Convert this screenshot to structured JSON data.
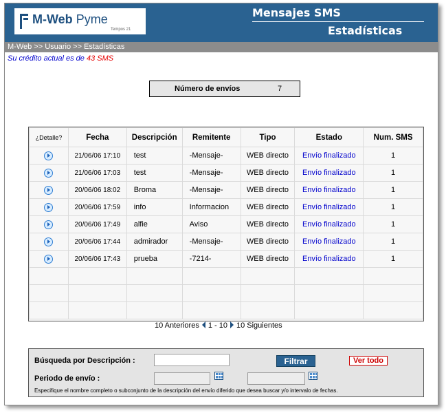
{
  "header": {
    "logo_text_prefix": "M-Web",
    "logo_text_suffix": "Pyme",
    "logo_tagline": "Tempos 21",
    "title": "Mensajes SMS",
    "subtitle": "Estadísticas"
  },
  "breadcrumb": "M-Web >> Usuario >> Estadísticas",
  "credit": {
    "text": "Su crédito actual es de ",
    "amount": "43 SMS"
  },
  "summary": {
    "label": "Número de envíos",
    "value": "7"
  },
  "table": {
    "columns": [
      "¿Detalle?",
      "Fecha",
      "Descripción",
      "Remitente",
      "Tipo",
      "Estado",
      "Num. SMS"
    ],
    "rows": [
      {
        "fecha": "21/06/06 17:10",
        "descripcion": "test",
        "remitente": "-Mensaje-",
        "tipo": "WEB directo",
        "estado": "Envío finalizado",
        "num": "1"
      },
      {
        "fecha": "21/06/06 17:03",
        "descripcion": "test",
        "remitente": "-Mensaje-",
        "tipo": "WEB directo",
        "estado": "Envío finalizado",
        "num": "1"
      },
      {
        "fecha": "20/06/06 18:02",
        "descripcion": "Broma",
        "remitente": "-Mensaje-",
        "tipo": "WEB directo",
        "estado": "Envío finalizado",
        "num": "1"
      },
      {
        "fecha": "20/06/06 17:59",
        "descripcion": "info",
        "remitente": "Informacion",
        "tipo": "WEB directo",
        "estado": "Envío finalizado",
        "num": "1"
      },
      {
        "fecha": "20/06/06 17:49",
        "descripcion": "alfie",
        "remitente": "Aviso",
        "tipo": "WEB directo",
        "estado": "Envío finalizado",
        "num": "1"
      },
      {
        "fecha": "20/06/06 17:44",
        "descripcion": "admirador",
        "remitente": "-Mensaje-",
        "tipo": "WEB directo",
        "estado": "Envío finalizado",
        "num": "1"
      },
      {
        "fecha": "20/06/06 17:43",
        "descripcion": "prueba",
        "remitente": "-7214-",
        "tipo": "WEB directo",
        "estado": "Envío finalizado",
        "num": "1"
      }
    ],
    "detail_icon": "play-circle-icon"
  },
  "pager": {
    "prev": "10 Anteriores",
    "range": "1 - 10",
    "next": "10 Siguientes"
  },
  "search": {
    "desc_label": "Búsqueda por Descripción :",
    "desc_value": "",
    "period_label": "Periodo de envío :",
    "date_from": "",
    "date_to": "",
    "filter_label": "Filtrar",
    "show_all_label": "Ver todo",
    "hint": "Especifique el nombre completo o subconjunto de la descripción del envío diferido que desea buscar y/o intervalo de fechas.",
    "calendar_icon": "calendar-icon"
  },
  "colors": {
    "header_blue": "#2a6291",
    "link_blue": "#0000cc",
    "credit_red": "#e60000"
  }
}
